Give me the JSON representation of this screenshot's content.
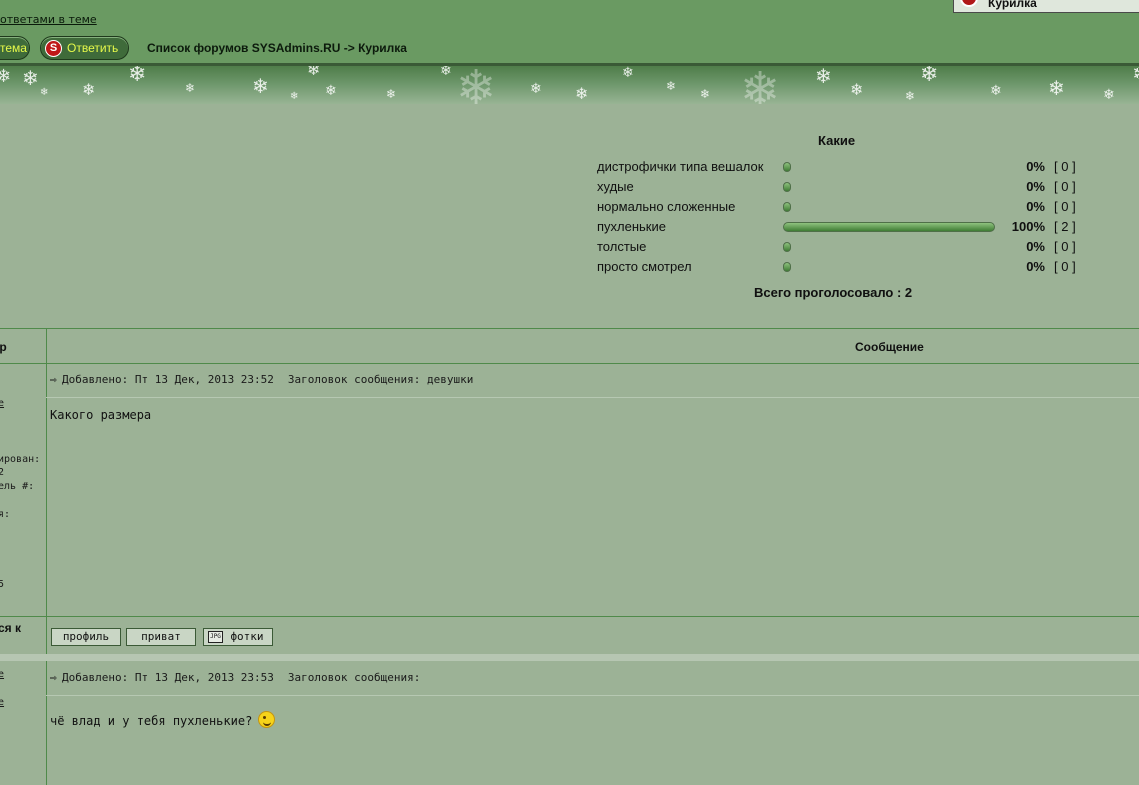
{
  "header": {
    "topic_link": "ответами в теме",
    "new_topic_label": "тема",
    "reply_label": "Ответить",
    "reply_icon_letter": "S",
    "breadcrumb": "Список форумов SYSAdmins.RU -> Курилка",
    "forum_jump": "Курилка"
  },
  "poll": {
    "title": "Какие",
    "options": [
      {
        "label": "дистрофички типа вешалок",
        "percent": 0,
        "percent_text": "0%",
        "count_text": "[ 0 ]"
      },
      {
        "label": "худые",
        "percent": 0,
        "percent_text": "0%",
        "count_text": "[ 0 ]"
      },
      {
        "label": "нормально сложенные",
        "percent": 0,
        "percent_text": "0%",
        "count_text": "[ 0 ]"
      },
      {
        "label": "пухленькие",
        "percent": 100,
        "percent_text": "100%",
        "count_text": "[ 2 ]"
      },
      {
        "label": "толстые",
        "percent": 0,
        "percent_text": "0%",
        "count_text": "[ 0 ]"
      },
      {
        "label": "просто смотрел",
        "percent": 0,
        "percent_text": "0%",
        "count_text": "[ 0 ]"
      }
    ],
    "total": "Всего проголосовало : 2"
  },
  "table": {
    "author_header": "ор",
    "message_header": "Сообщение"
  },
  "posts": [
    {
      "meta_date": "Добавлено: Пт 13 Дек, 2013 23:52",
      "meta_subject": "Заголовок сообщения: девушки",
      "body": "Какого размера",
      "sidebar": [
        "е",
        "ирован:",
        "2",
        "ель #:",
        "я:",
        "5"
      ]
    },
    {
      "meta_date": "Добавлено: Пт 13 Дек, 2013 23:53",
      "meta_subject": "Заголовок сообщения:",
      "body": "чё влад и у тебя пухленькие?",
      "sidebar": [
        "е",
        "е"
      ]
    }
  ],
  "actions": {
    "connect_label": "ся к",
    "profile_label": "профиль",
    "pm_label": "приват",
    "photos_label": "фотки",
    "photos_icon_text": "JPG"
  },
  "colors": {
    "header_bg": "#6a9a62",
    "page_bg": "#9cb296",
    "button_text": "#e6f94a",
    "poll_bar": "#3f7d34"
  }
}
